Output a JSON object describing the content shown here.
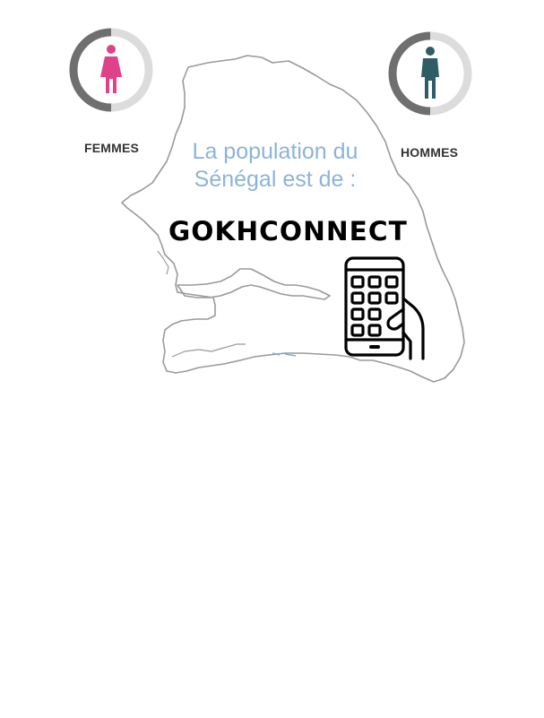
{
  "gauges": {
    "women": {
      "label": "FEMMES",
      "color": "#e0428a",
      "icon": "woman-icon"
    },
    "men": {
      "label": "HOMMES",
      "color": "#2e5d66",
      "icon": "man-icon"
    }
  },
  "headline": {
    "line1": "La population du",
    "line2": "Sénégal est de :"
  },
  "brand": {
    "name": "GOKHCONNECT"
  },
  "icons": {
    "phone": "smartphone-touch-icon",
    "map": "senegal-map-outline"
  },
  "colors": {
    "headline": "#8cb4d8",
    "gauge_track": "#dcdcdc",
    "gauge_fill": "#6f6f6f",
    "map_outline": "#9a9a9a"
  }
}
